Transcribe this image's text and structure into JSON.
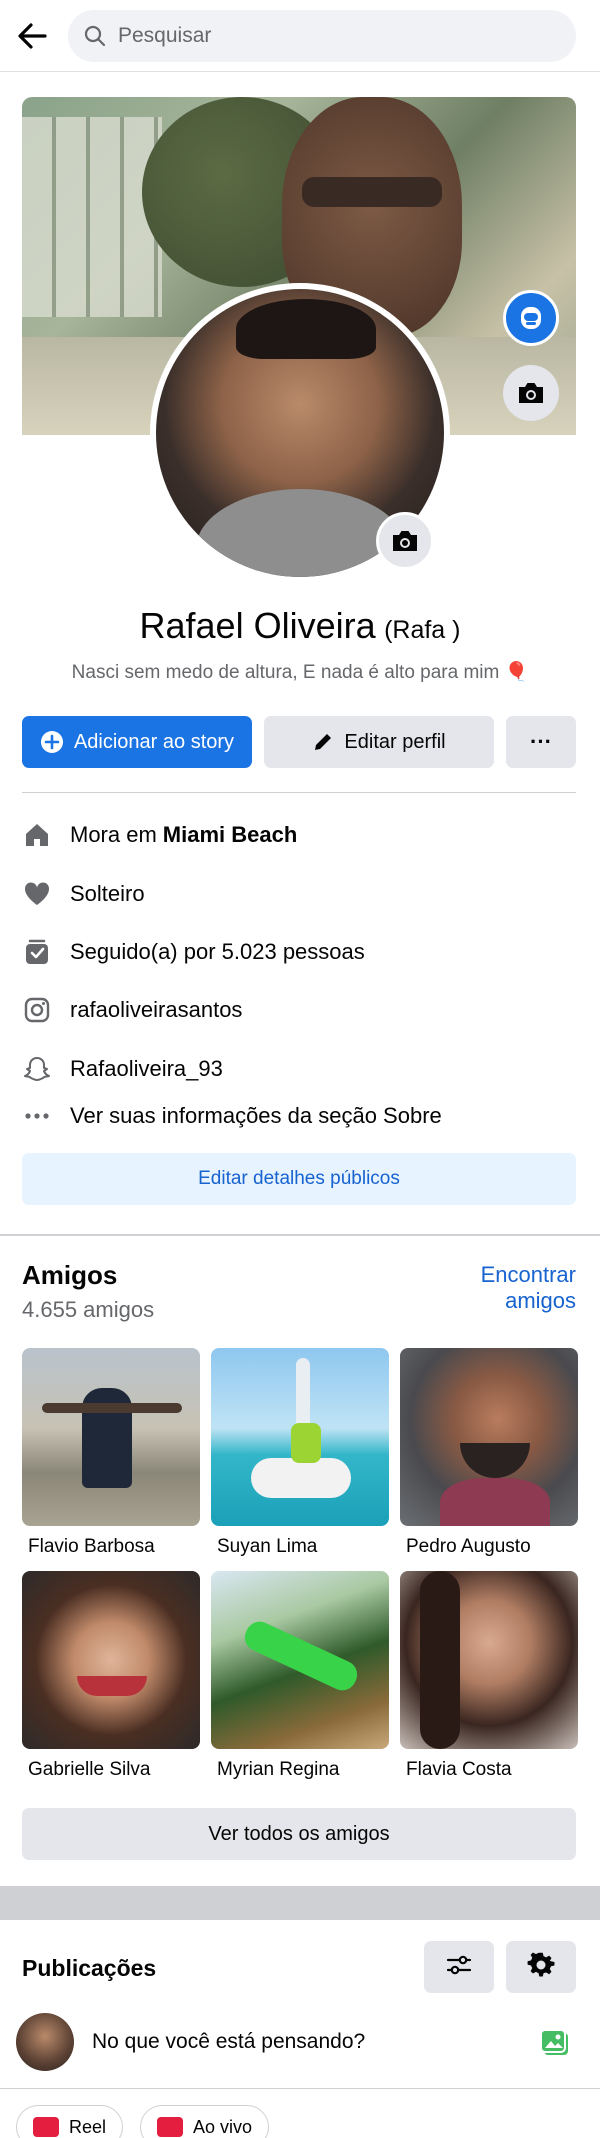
{
  "topbar": {
    "search_placeholder": "Pesquisar"
  },
  "profile": {
    "name": "Rafael Oliveira",
    "nickname": "(Rafa )",
    "bio": "Nasci sem medo de altura, E nada é alto para mim",
    "bio_emoji": "🎈"
  },
  "actions": {
    "add_story": "Adicionar ao story",
    "edit_profile": "Editar perfil",
    "more": "···"
  },
  "details": {
    "lives_prefix": "Mora em",
    "lives_city": "Miami Beach",
    "relationship": "Solteiro",
    "followers": "Seguido(a) por 5.023 pessoas",
    "instagram": "rafaoliveirasantos",
    "snapchat": "Rafaoliveira_93",
    "see_about": "Ver suas informações da seção Sobre",
    "edit_public": "Editar detalhes públicos"
  },
  "friends": {
    "title": "Amigos",
    "count": "4.655 amigos",
    "find": "Encontrar amigos",
    "list": [
      {
        "name": "Flavio Barbosa"
      },
      {
        "name": "Suyan Lima"
      },
      {
        "name": "Pedro Augusto"
      },
      {
        "name": "Gabrielle Silva"
      },
      {
        "name": "Myrian Regina"
      },
      {
        "name": "Flavia Costa"
      }
    ],
    "see_all": "Ver todos os amigos"
  },
  "publications": {
    "title": "Publicações",
    "composer_prompt": "No que você está pensando?",
    "chips": [
      "Reel",
      "Ao vivo"
    ]
  },
  "colors": {
    "accent": "#1b74e4",
    "link": "#1763cf",
    "light_blue_bg": "#e7f3ff",
    "gray_button": "#e4e6eb",
    "secondary_text": "#65676b"
  }
}
